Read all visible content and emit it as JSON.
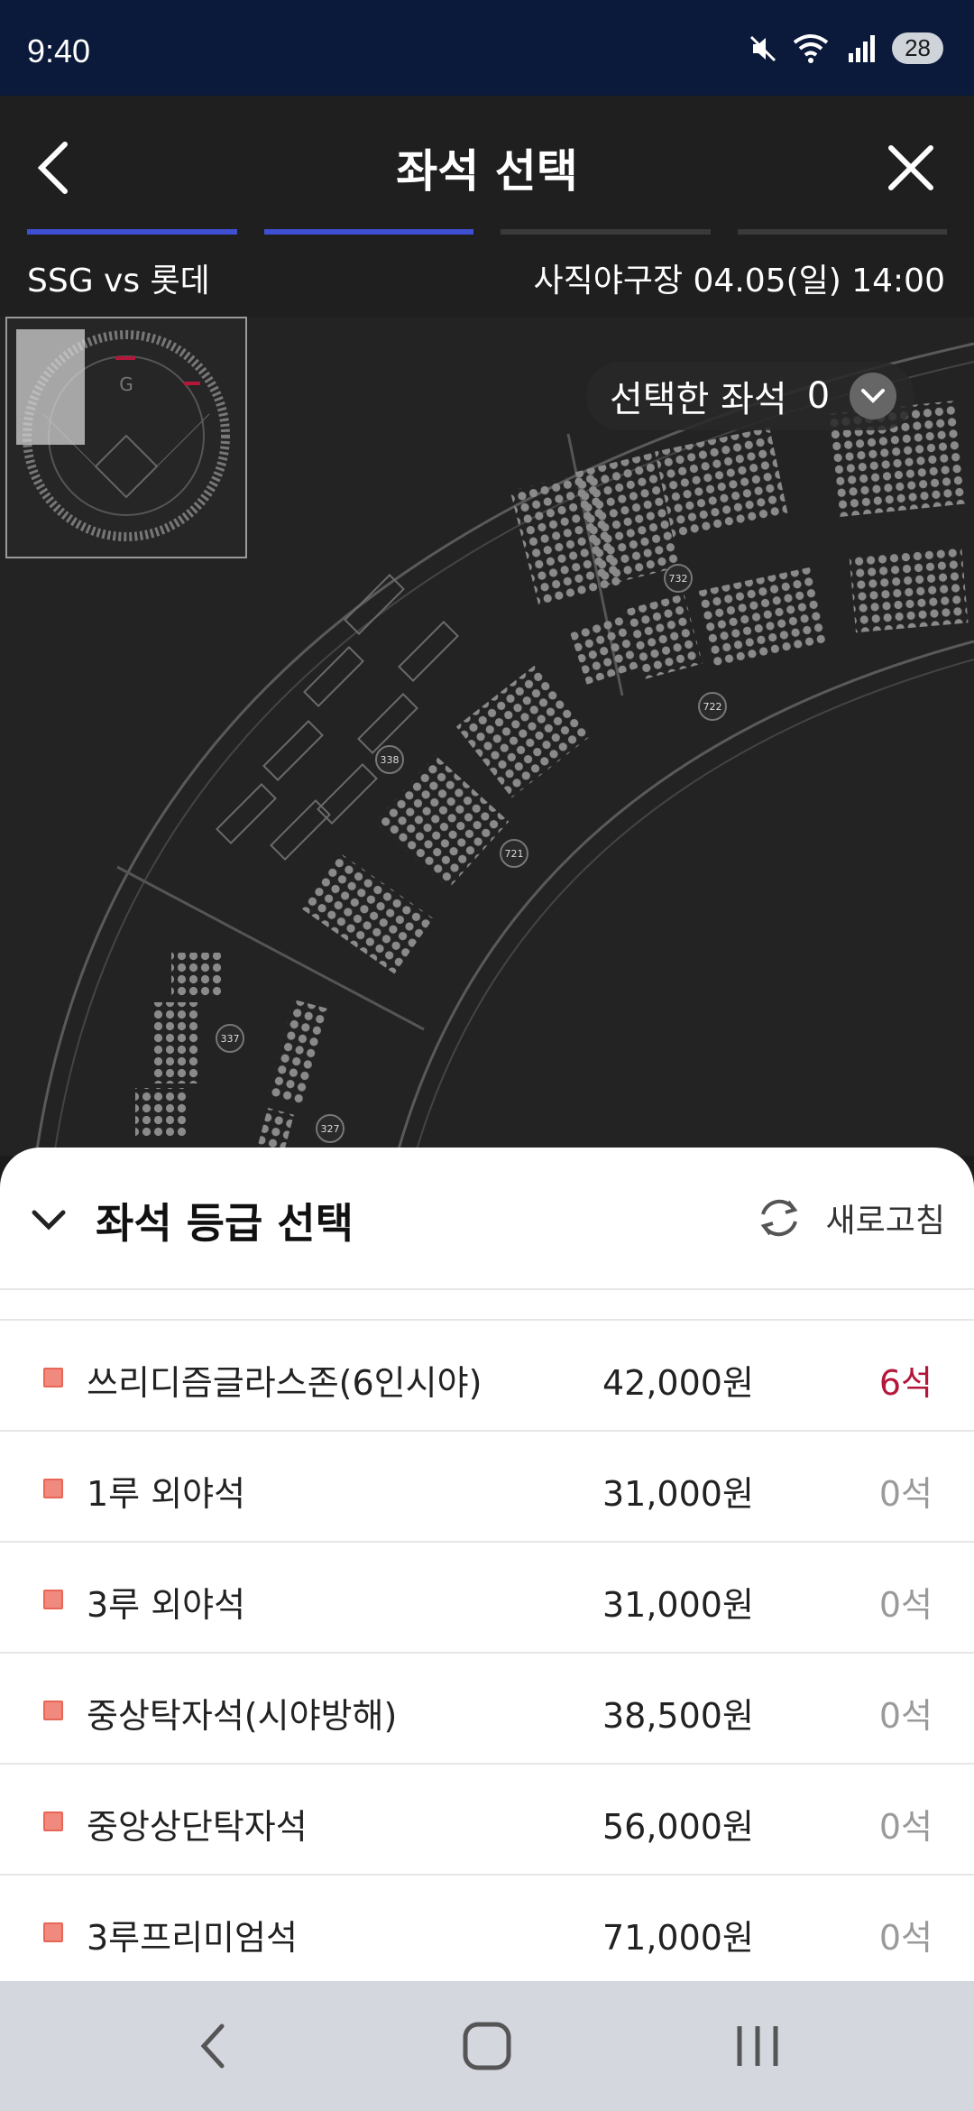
{
  "status_bar": {
    "time": "9:40",
    "battery": "28",
    "wifi_label": "5"
  },
  "header": {
    "title": "좌석 선택",
    "match": "SSG vs 롯데",
    "venue_datetime": "사직야구장 04.05(일) 14:00",
    "progress_steps": [
      true,
      true,
      false,
      false
    ]
  },
  "map": {
    "selected_label": "선택한 좌석",
    "selected_count": "0",
    "section_labels": [
      "732",
      "722",
      "721",
      "338",
      "337",
      "327"
    ]
  },
  "sheet": {
    "title": "좌석 등급 선택",
    "refresh_label": "새로고침",
    "items": [
      {
        "name": "쓰리디즘글라스존(6인시야)",
        "price": "42,000원",
        "count": "6석",
        "available": true
      },
      {
        "name": "1루 외야석",
        "price": "31,000원",
        "count": "0석",
        "available": false
      },
      {
        "name": "3루 외야석",
        "price": "31,000원",
        "count": "0석",
        "available": false
      },
      {
        "name": "중상탁자석(시야방해)",
        "price": "38,500원",
        "count": "0석",
        "available": false
      },
      {
        "name": "중앙상단탁자석",
        "price": "56,000원",
        "count": "0석",
        "available": false
      },
      {
        "name": "3루프리미엄석",
        "price": "71,000원",
        "count": "0석",
        "available": false
      }
    ]
  },
  "colors": {
    "accent": "#3f4fd1",
    "available": "#b3173a",
    "swatch": "#f08a7e"
  }
}
